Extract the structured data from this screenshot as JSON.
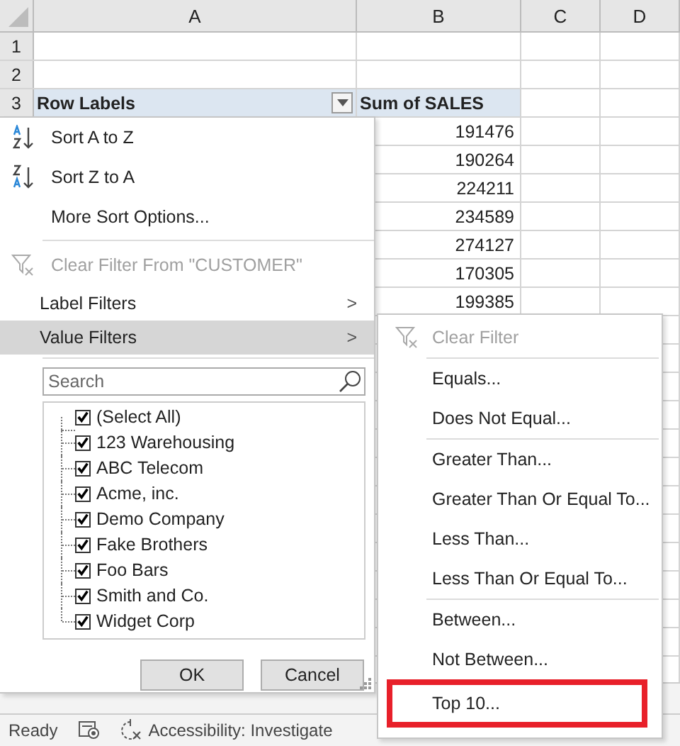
{
  "sheet": {
    "columns": [
      "A",
      "B",
      "C",
      "D"
    ],
    "rows": [
      {
        "number": "1",
        "cells": [
          "",
          ""
        ],
        "header": false
      },
      {
        "number": "2",
        "cells": [
          "",
          ""
        ],
        "header": false
      },
      {
        "number": "3",
        "cells": [
          "Row Labels",
          "Sum of SALES"
        ],
        "header": true
      }
    ],
    "sales_values": [
      "191476",
      "190264",
      "224211",
      "234589",
      "274127",
      "170305",
      "199385"
    ]
  },
  "filter_menu": {
    "items": [
      {
        "kind": "sort",
        "label": "Sort A to Z"
      },
      {
        "kind": "sort",
        "label": "Sort Z to A"
      },
      {
        "kind": "item",
        "label": "More Sort Options..."
      },
      {
        "kind": "divider"
      },
      {
        "kind": "clear",
        "label": "Clear Filter From \"CUSTOMER\"",
        "disabled": true
      },
      {
        "kind": "submenu",
        "label": "Label Filters",
        "selected": false,
        "arrow": ">"
      },
      {
        "kind": "submenu",
        "label": "Value Filters",
        "selected": true,
        "arrow": ">"
      }
    ],
    "search": {
      "placeholder": "Search"
    },
    "checklist": [
      {
        "label": "(Select All)",
        "checked": true
      },
      {
        "label": "123 Warehousing",
        "checked": true
      },
      {
        "label": "ABC Telecom",
        "checked": true
      },
      {
        "label": "Acme, inc.",
        "checked": true
      },
      {
        "label": "Demo Company",
        "checked": true
      },
      {
        "label": "Fake Brothers",
        "checked": true
      },
      {
        "label": "Foo Bars",
        "checked": true
      },
      {
        "label": "Smith and Co.",
        "checked": true
      },
      {
        "label": "Widget Corp",
        "checked": true
      }
    ],
    "buttons": [
      "OK",
      "Cancel"
    ]
  },
  "value_filters_menu": {
    "items": [
      {
        "kind": "clear",
        "label": "Clear Filter",
        "disabled": true,
        "highlighted": false
      },
      {
        "kind": "divider"
      },
      {
        "kind": "item",
        "label": "Equals...",
        "disabled": false,
        "highlighted": false
      },
      {
        "kind": "item",
        "label": "Does Not Equal...",
        "disabled": false,
        "highlighted": false
      },
      {
        "kind": "divider"
      },
      {
        "kind": "item",
        "label": "Greater Than...",
        "disabled": false,
        "highlighted": false
      },
      {
        "kind": "item",
        "label": "Greater Than Or Equal To...",
        "disabled": false,
        "highlighted": false
      },
      {
        "kind": "item",
        "label": "Less Than...",
        "disabled": false,
        "highlighted": false
      },
      {
        "kind": "item",
        "label": "Less Than Or Equal To...",
        "disabled": false,
        "highlighted": false
      },
      {
        "kind": "divider"
      },
      {
        "kind": "item",
        "label": "Between...",
        "disabled": false,
        "highlighted": false
      },
      {
        "kind": "item",
        "label": "Not Between...",
        "disabled": false,
        "highlighted": false
      },
      {
        "kind": "item",
        "label": "Top 10...",
        "disabled": false,
        "highlighted": true
      }
    ]
  },
  "status_bar": {
    "status": "Ready",
    "accessibility": "Accessibility: Investigate"
  }
}
